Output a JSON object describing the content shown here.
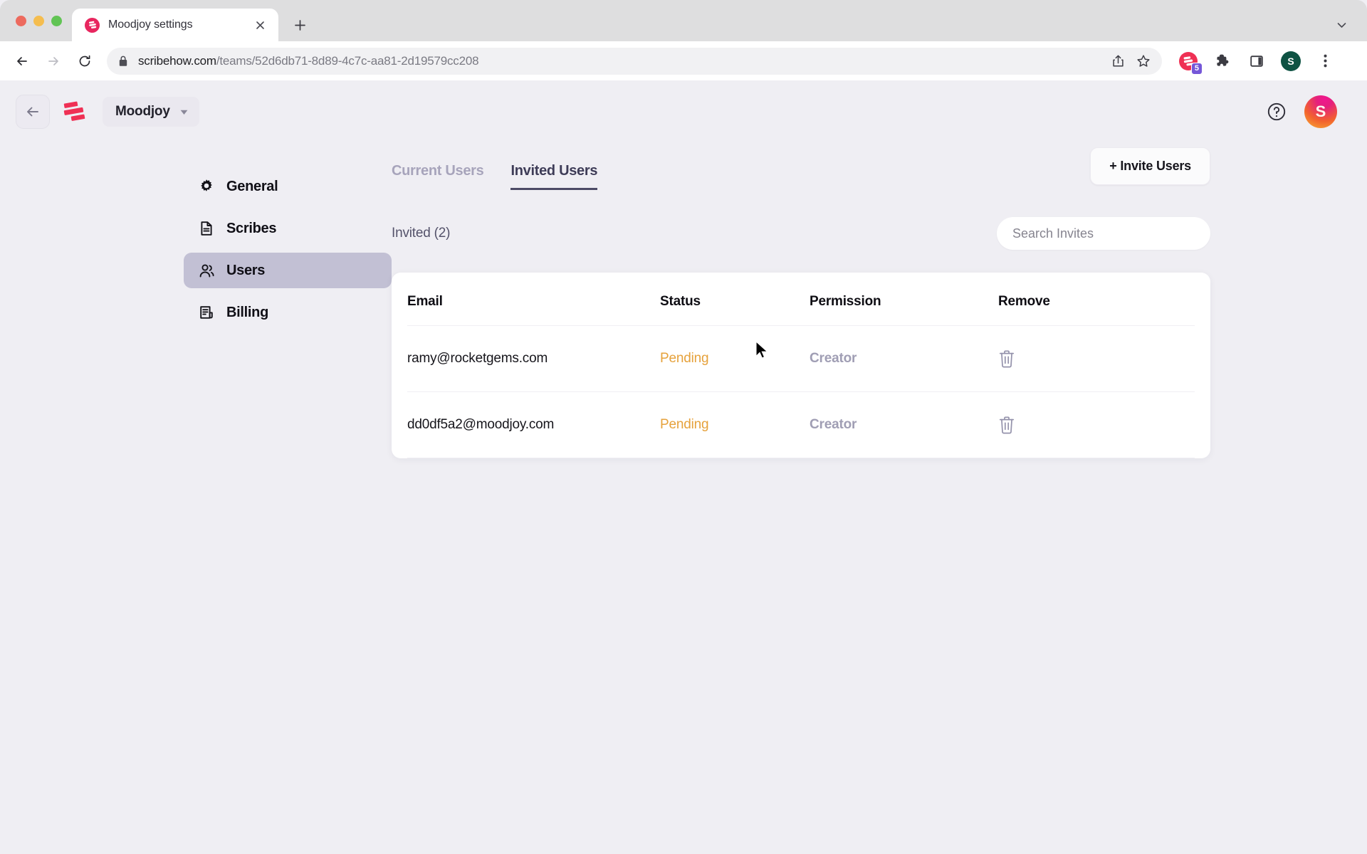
{
  "browser": {
    "tab": {
      "title": "Moodjoy settings",
      "favicon": "scribe-logo-icon",
      "close": "close-icon"
    },
    "new_tab_label": "+",
    "tab_list_chevron": "chevron-down-icon",
    "nav": {
      "back": "back-arrow-icon",
      "forward": "forward-arrow-icon",
      "reload": "reload-icon"
    },
    "omnibox": {
      "lock": "lock-icon",
      "url_domain": "scribehow.com",
      "url_path": "/teams/52d6db71-8d89-4c7c-aa81-2d19579cc208",
      "share": "share-icon",
      "bookmark": "star-icon"
    },
    "toolbar_icons": [
      {
        "name": "scribe-extension-icon",
        "badge": "5"
      },
      {
        "name": "extensions-puzzle-icon"
      },
      {
        "name": "side-panel-icon"
      },
      {
        "name": "profile-avatar",
        "initial": "S"
      },
      {
        "name": "chrome-menu-icon"
      }
    ]
  },
  "app": {
    "header": {
      "back": "back-arrow-icon",
      "logo": "scribe-logo-icon",
      "workspace": "Moodjoy",
      "workspace_chevron": "chevron-down-icon",
      "help": "help-circle-icon",
      "avatar_initial": "S"
    },
    "sidebar": {
      "items": [
        {
          "label": "General",
          "icon": "gear-icon",
          "active": false
        },
        {
          "label": "Scribes",
          "icon": "document-icon",
          "active": false
        },
        {
          "label": "Users",
          "icon": "users-icon",
          "active": true
        },
        {
          "label": "Billing",
          "icon": "receipt-icon",
          "active": false
        }
      ]
    },
    "main": {
      "tabs": [
        {
          "label": "Current Users",
          "active": false
        },
        {
          "label": "Invited Users",
          "active": true
        }
      ],
      "invite_button": "+ Invite Users",
      "invited_count_label": "Invited (2)",
      "search": {
        "placeholder": "Search Invites",
        "value": ""
      },
      "table": {
        "columns": [
          "Email",
          "Status",
          "Permission",
          "Remove"
        ],
        "rows": [
          {
            "email": "ramy@rocketgems.com",
            "status": "Pending",
            "permission": "Creator",
            "remove_icon": "trash-icon"
          },
          {
            "email": "dd0df5a2@moodjoy.com",
            "status": "Pending",
            "permission": "Creator",
            "remove_icon": "trash-icon"
          }
        ]
      }
    }
  },
  "colors": {
    "brand_red": "#ef3054",
    "page_bg": "#efeef3",
    "active_nav": "#c2c0d4",
    "status_pending": "#e6a23c",
    "permission_text": "#a09eb4",
    "tab_active": "#3e3c57",
    "tab_inactive": "#a7a4bb"
  }
}
